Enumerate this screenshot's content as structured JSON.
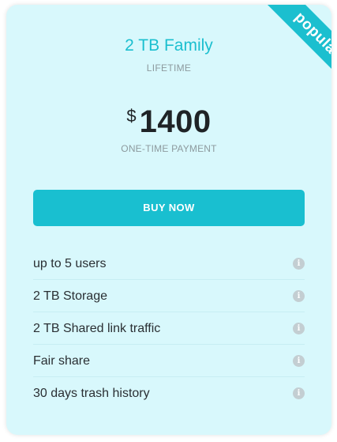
{
  "badge": {
    "label": "popular"
  },
  "plan": {
    "name": "2 TB Family",
    "term": "LIFETIME"
  },
  "price": {
    "currency": "$",
    "amount": "1400",
    "note": "ONE-TIME PAYMENT"
  },
  "cta": {
    "label": "BUY NOW"
  },
  "features": [
    {
      "label": "up to 5 users",
      "icon": "info-icon"
    },
    {
      "label": "2 TB Storage",
      "icon": "info-icon"
    },
    {
      "label": "2 TB Shared link traffic",
      "icon": "info-icon"
    },
    {
      "label": "Fair share",
      "icon": "info-icon"
    },
    {
      "label": "30 days trash history",
      "icon": "info-icon"
    }
  ],
  "colors": {
    "accent": "#1bbfcf",
    "card_background": "#d8f8fc",
    "info_icon": "#c3ced2"
  }
}
